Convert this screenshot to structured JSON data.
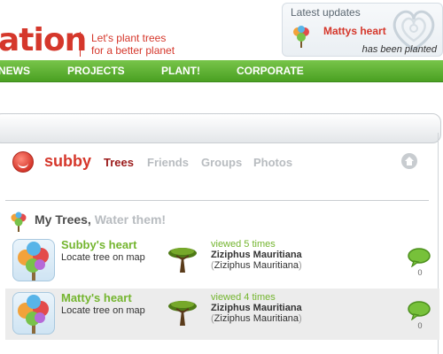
{
  "header": {
    "logo_text": "ation",
    "tagline_line1": "Let's plant trees",
    "tagline_line2": "for a better planet",
    "latest_updates": {
      "title": "Latest updates",
      "tree_name": "Mattys heart",
      "status": "has been planted"
    }
  },
  "nav": {
    "items": [
      "NEWS",
      "PROJECTS",
      "PLANT!",
      "CORPORATE"
    ]
  },
  "profile": {
    "username": "subby",
    "tabs": [
      "Trees",
      "Friends",
      "Groups",
      "Photos"
    ],
    "active_tab": "Trees"
  },
  "section": {
    "title": "My Trees,",
    "subtitle": "Water them!"
  },
  "trees": [
    {
      "name": "Subby's heart",
      "locate": "Locate tree on map",
      "views": "viewed 5 times",
      "species": "Ziziphus Mauritiana",
      "scientific": "Ziziphus Mauritiana",
      "comments": "0"
    },
    {
      "name": "Matty's heart",
      "locate": "Locate tree on map",
      "views": "viewed 4 times",
      "species": "Ziziphus Mauritiana",
      "scientific": "Ziziphus Mauritiana",
      "comments": "0"
    }
  ],
  "icons": {
    "update_tree": "tree-icon",
    "profile_avatar": "smiley-avatar-icon",
    "home": "home-icon",
    "section": "tree-icon",
    "species": "acacia-tree-icon",
    "comment": "speech-bubble-icon"
  },
  "colors": {
    "brand_red": "#d5372b",
    "nav_green": "#5aae31",
    "link_green": "#74b52f",
    "muted_gray": "#b8bcc0",
    "active_tab": "#9b1a1a"
  }
}
